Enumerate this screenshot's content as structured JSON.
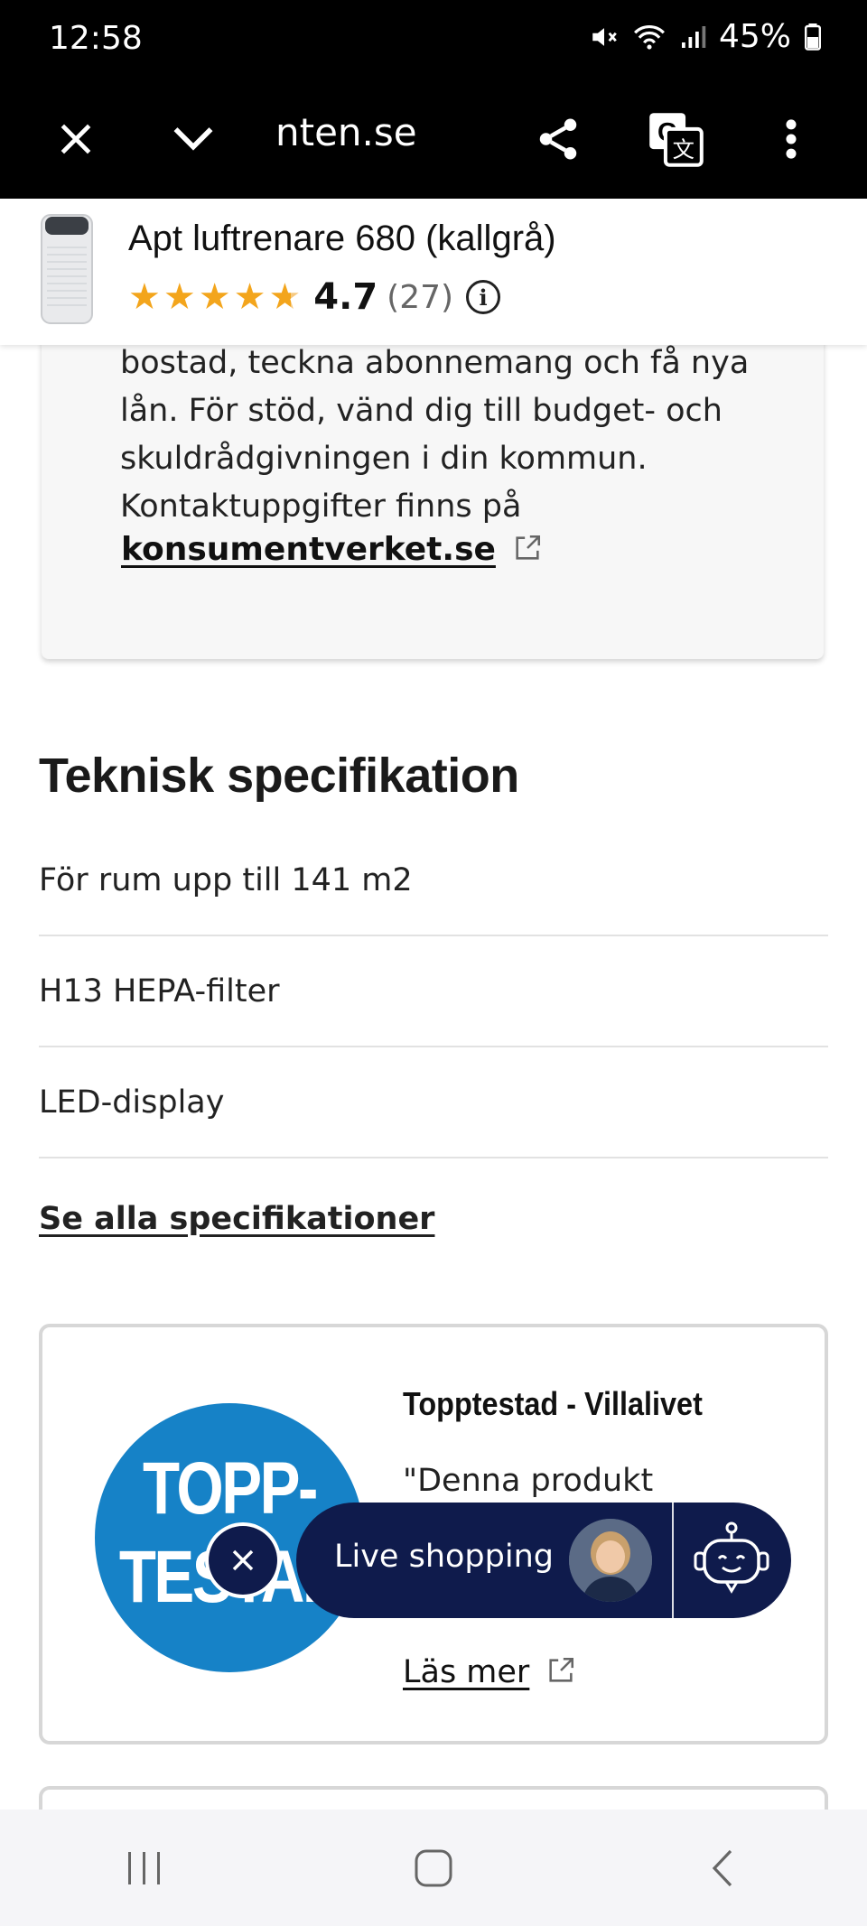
{
  "status_bar": {
    "time": "12:58",
    "battery": "45%",
    "icons": [
      "mute-icon",
      "wifi-icon",
      "signal-icon",
      "battery-icon"
    ]
  },
  "browser": {
    "url": "nten.se",
    "close_icon": "close-icon",
    "collapse_icon": "chevron-down-icon",
    "share_icon": "share-icon",
    "translate_icon": "translate-icon",
    "menu_icon": "more-vertical-icon"
  },
  "product": {
    "name": "Apt luftrenare 680 (kallgrå)",
    "rating": "4.7",
    "rating_count": "(27)",
    "stars": 4.7,
    "info_icon_glyph": "i"
  },
  "info_card": {
    "text": "bostad, teckna abonnemang och få nya lån. För stöd, vänd dig till budget- och skuldrådgivningen i din kommun. Kontaktuppgifter finns på",
    "link": "konsumentverket.se"
  },
  "specs": {
    "heading": "Teknisk specifikation",
    "items": [
      "För rum upp till 141 m2",
      "H13 HEPA-filter",
      "LED-display"
    ],
    "see_all": "Se alla specifikationer"
  },
  "award": {
    "badge_line1": "TOPP-",
    "badge_line2": "TESTAD",
    "title": "Topptestad - Villalivet",
    "quote": "\"Denna produkt",
    "link": "Läs mer"
  },
  "live_shopping": {
    "label": "Live shopping"
  },
  "colors": {
    "star": "#f3a51c",
    "live_bg": "#0f1b4c",
    "badge": "#1682c7"
  }
}
